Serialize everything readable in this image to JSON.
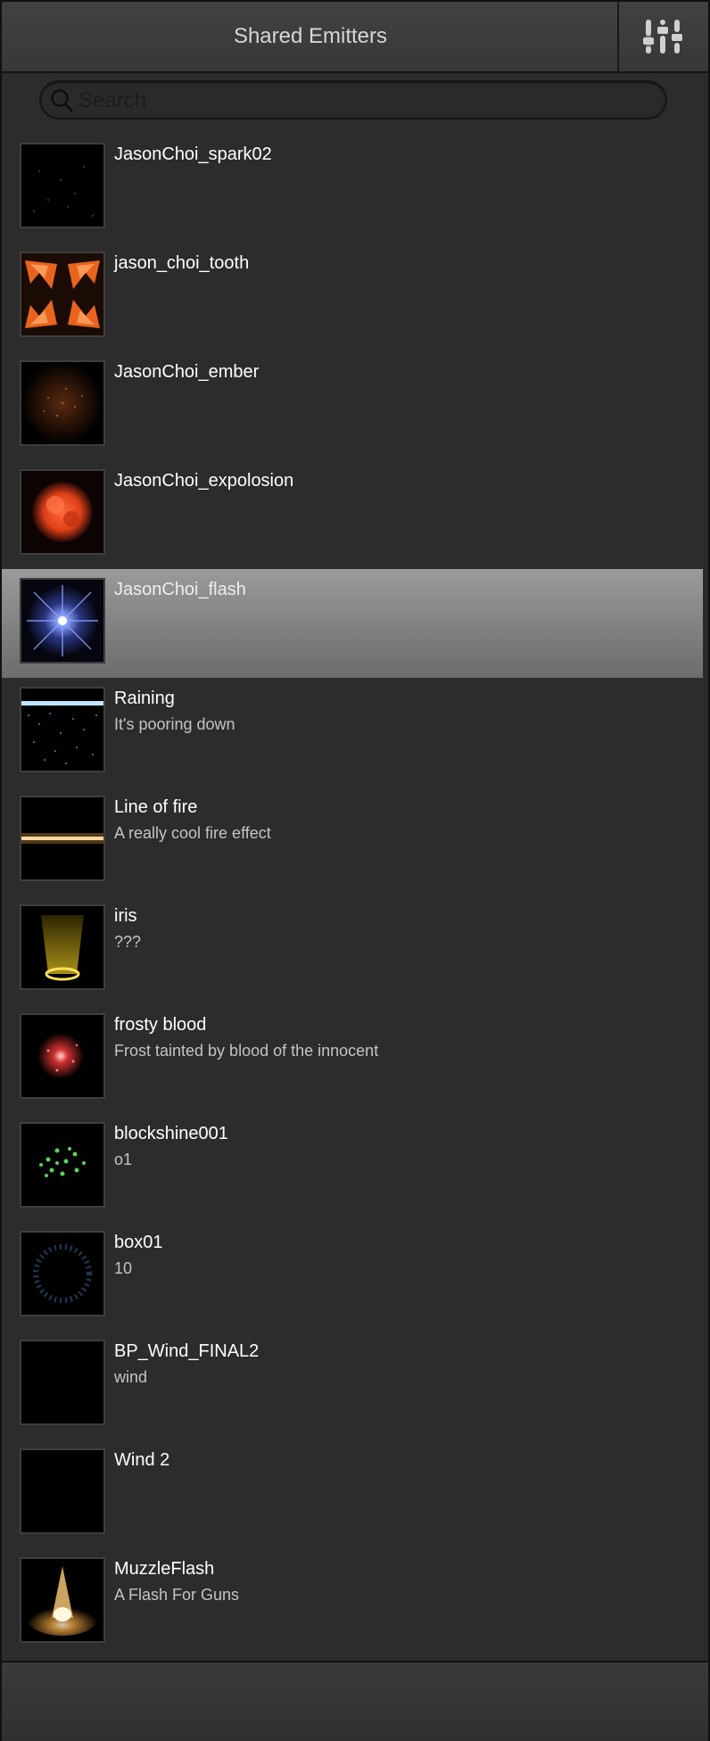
{
  "header": {
    "title": "Shared Emitters",
    "settings_icon": "sliders-icon"
  },
  "search": {
    "placeholder": "Search",
    "value": ""
  },
  "emitters": [
    {
      "name": "JasonChoi_spark02",
      "description": "",
      "thumb": "spark"
    },
    {
      "name": "jason_choi_tooth",
      "description": "",
      "thumb": "tooth"
    },
    {
      "name": "JasonChoi_ember",
      "description": "",
      "thumb": "ember"
    },
    {
      "name": "JasonChoi_expolosion",
      "description": "",
      "thumb": "explosion"
    },
    {
      "name": "JasonChoi_flash",
      "description": "",
      "thumb": "flash",
      "selected": true
    },
    {
      "name": "Raining",
      "description": "It's pooring down",
      "thumb": "rain"
    },
    {
      "name": "Line of fire",
      "description": "A really cool fire effect",
      "thumb": "fireline"
    },
    {
      "name": "iris",
      "description": "???",
      "thumb": "iris"
    },
    {
      "name": "frosty blood",
      "description": "Frost tainted by blood of the innocent",
      "thumb": "blood"
    },
    {
      "name": "blockshine001",
      "description": "o1",
      "thumb": "green"
    },
    {
      "name": "box01",
      "description": "10",
      "thumb": "box"
    },
    {
      "name": "BP_Wind_FINAL2",
      "description": "wind",
      "thumb": "black"
    },
    {
      "name": "Wind 2",
      "description": "",
      "thumb": "black"
    },
    {
      "name": "MuzzleFlash",
      "description": "A Flash For Guns",
      "thumb": "muzzle"
    }
  ],
  "colors": {
    "background": "#2c2c2c",
    "selected_row": "#8a8a8a",
    "title_text": "#d6d6d6",
    "description_text": "#c4c4c4"
  }
}
